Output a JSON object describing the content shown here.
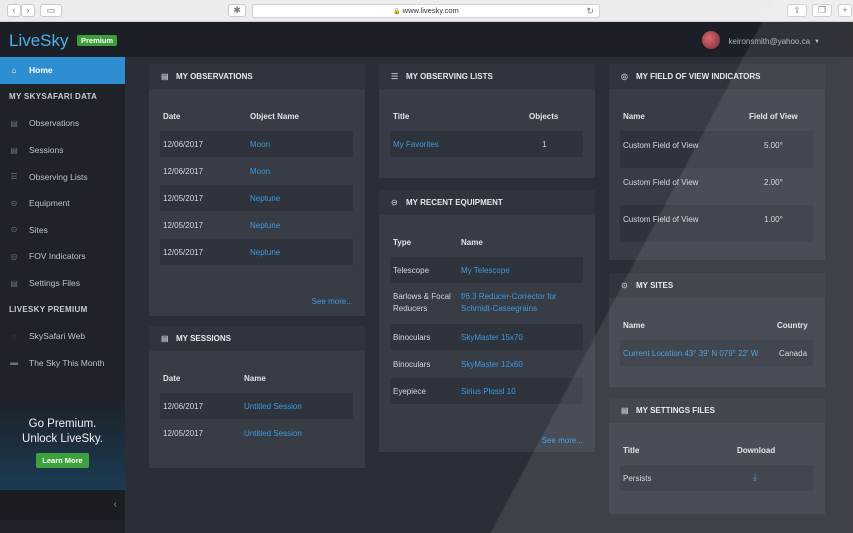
{
  "browser": {
    "url": "www.livesky.com"
  },
  "header": {
    "logo": "LiveSky",
    "badge": "Premium",
    "user_email": "keironsmith@yahoo.ca"
  },
  "sidebar": {
    "home": "Home",
    "section1": "MY SKYSAFARI DATA",
    "items": [
      "Observations",
      "Sessions",
      "Observing Lists",
      "Equipment",
      "Sites",
      "FOV Indicators",
      "Settings Files"
    ],
    "section2": "LIVESKY PREMIUM",
    "premium_items": [
      "SkySafari Web",
      "The Sky This Month"
    ],
    "promo_line1": "Go Premium.",
    "promo_line2": "Unlock LiveSky.",
    "learn_more": "Learn More"
  },
  "observations": {
    "title": "MY OBSERVATIONS",
    "col_date": "Date",
    "col_object": "Object Name",
    "rows": [
      [
        "12/06/2017",
        "Moon"
      ],
      [
        "12/06/2017",
        "Moon"
      ],
      [
        "12/05/2017",
        "Neptune"
      ],
      [
        "12/05/2017",
        "Neptune"
      ],
      [
        "12/05/2017",
        "Neptune"
      ]
    ],
    "see_more": "See more..."
  },
  "sessions": {
    "title": "MY SESSIONS",
    "col_date": "Date",
    "col_name": "Name",
    "rows": [
      [
        "12/06/2017",
        "Untitled Session"
      ],
      [
        "12/05/2017",
        "Untitled Session"
      ]
    ]
  },
  "lists": {
    "title": "MY OBSERVING LISTS",
    "col_title": "Title",
    "col_objects": "Objects",
    "rows": [
      [
        "My Favorites",
        "1"
      ]
    ]
  },
  "equipment": {
    "title": "MY RECENT EQUIPMENT",
    "col_type": "Type",
    "col_name": "Name",
    "rows": [
      [
        "Telescope",
        "",
        "My Telescope",
        ""
      ],
      [
        "Barlows & Focal",
        "Reducers",
        "f/6.3 Reducer-Corrector for",
        "Schmidt-Cassegrains"
      ],
      [
        "Binoculars",
        "",
        "SkyMaster 15x70",
        ""
      ],
      [
        "Binoculars",
        "",
        "SkyMaster 12x60",
        ""
      ],
      [
        "Eyepiece",
        "",
        "Sirius Plossl 10",
        ""
      ]
    ],
    "see_more": "See more..."
  },
  "fov": {
    "title": "MY FIELD OF VIEW INDICATORS",
    "col_name": "Name",
    "col_fov": "Field of View",
    "rows": [
      [
        "Custom Field of View",
        "5.00°"
      ],
      [
        "Custom Field of View",
        "2.00°"
      ],
      [
        "Custom Field of View",
        "1.00°"
      ]
    ]
  },
  "sites": {
    "title": "MY SITES",
    "col_name": "Name",
    "col_country": "Country",
    "rows": [
      [
        "Current Location 43° 39' N 079° 22' W",
        "Canada"
      ]
    ]
  },
  "settings": {
    "title": "MY SETTINGS FILES",
    "col_title": "Title",
    "col_download": "Download",
    "rows": [
      [
        "Persists"
      ]
    ]
  }
}
